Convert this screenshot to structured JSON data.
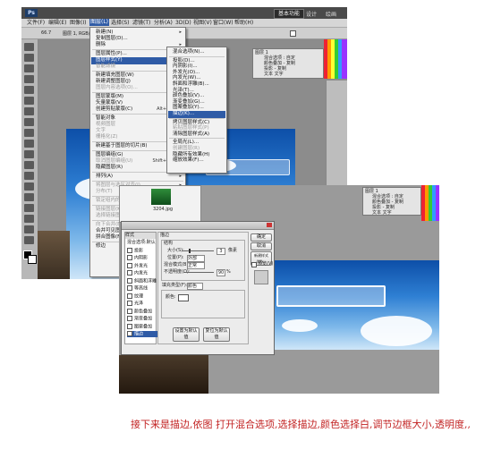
{
  "screen1": {
    "menubar": [
      "文件(F)",
      "编辑(E)",
      "图像(I)",
      "图层(L)",
      "选择(S)",
      "滤镜(T)",
      "分析(A)",
      "3D(D)",
      "视图(V)",
      "窗口(W)",
      "帮助(H)"
    ],
    "workspace_button": "基本功能",
    "top_right_items": [
      "设计",
      "绘画"
    ],
    "zoom": "66.7",
    "tab_title": "图层 1, RGB/8",
    "layer_menu": [
      {
        "label": "新建(N)",
        "arrow": true
      },
      {
        "label": "复制图层(D)...",
        "arrow": false
      },
      {
        "label": "删除",
        "arrow": true
      },
      {
        "sep": true
      },
      {
        "label": "图层属性(P)...",
        "arrow": false
      },
      {
        "label": "图层样式(Y)",
        "arrow": true,
        "highlight": true
      },
      {
        "label": "智能滤镜",
        "arrow": false,
        "disabled": true
      },
      {
        "sep": true
      },
      {
        "label": "新建填充图层(W)",
        "arrow": true
      },
      {
        "label": "新建调整图层(J)",
        "arrow": true
      },
      {
        "label": "图层内容选项(O)...",
        "arrow": false,
        "disabled": true
      },
      {
        "sep": true
      },
      {
        "label": "图层蒙版(M)",
        "arrow": true
      },
      {
        "label": "矢量蒙版(V)",
        "arrow": true
      },
      {
        "label": "创建剪贴蒙版(C)",
        "shortcut": "Alt+Ctrl+G"
      },
      {
        "sep": true
      },
      {
        "label": "智能对象",
        "arrow": true
      },
      {
        "label": "视频图层",
        "arrow": true,
        "disabled": true
      },
      {
        "label": "文字",
        "arrow": true,
        "disabled": true
      },
      {
        "label": "栅格化(Z)",
        "arrow": true,
        "disabled": true
      },
      {
        "sep": true
      },
      {
        "label": "新建基于图层的切片(B)",
        "arrow": false
      },
      {
        "sep": true
      },
      {
        "label": "图层编组(G)",
        "shortcut": "Ctrl+G"
      },
      {
        "label": "取消图层编组(U)",
        "shortcut": "Shift+Ctrl+G",
        "disabled": true
      },
      {
        "label": "隐藏图层(R)",
        "arrow": false
      },
      {
        "sep": true
      },
      {
        "label": "排列(A)",
        "arrow": true
      },
      {
        "sep": true
      },
      {
        "label": "将图层与选区对齐(I)",
        "arrow": true,
        "disabled": true
      },
      {
        "label": "分布(T)",
        "arrow": true,
        "disabled": true
      },
      {
        "sep": true
      },
      {
        "label": "锁定组内的所有图层(X)...",
        "disabled": true
      },
      {
        "sep": true
      },
      {
        "label": "链接图层(K)",
        "disabled": true
      },
      {
        "label": "选择链接图层(S)",
        "disabled": true
      },
      {
        "sep": true
      },
      {
        "label": "向下合并(E)",
        "shortcut": "Ctrl+E",
        "disabled": true
      },
      {
        "label": "合并可见图层",
        "shortcut": "Shift+Ctrl+E"
      },
      {
        "label": "拼合图像(F)"
      },
      {
        "sep": true
      },
      {
        "label": "修边",
        "arrow": true
      }
    ],
    "style_submenu": [
      {
        "label": "混合选项(N)..."
      },
      {
        "sep": true
      },
      {
        "label": "投影(D)..."
      },
      {
        "label": "内阴影(I)..."
      },
      {
        "label": "外发光(O)..."
      },
      {
        "label": "内发光(W)..."
      },
      {
        "label": "斜面和浮雕(B)..."
      },
      {
        "label": "光泽(T)..."
      },
      {
        "label": "颜色叠加(V)..."
      },
      {
        "label": "渐变叠加(G)..."
      },
      {
        "label": "图案叠加(Y)..."
      },
      {
        "label": "描边(K)...",
        "highlight": true
      },
      {
        "sep": true
      },
      {
        "label": "拷贝图层样式(C)"
      },
      {
        "label": "粘贴图层样式(P)",
        "disabled": true
      },
      {
        "label": "清除图层样式(A)"
      },
      {
        "sep": true
      },
      {
        "label": "全局光(L)..."
      },
      {
        "label": "创建图层(R)",
        "disabled": true
      },
      {
        "label": "隐藏所有效果(H)"
      },
      {
        "label": "缩放效果(F)..."
      }
    ],
    "layers_panel": [
      "图层 1",
      "混合选项 : 自定",
      "颜色叠加 - 复制",
      "投影 - 复制",
      "文本 文字"
    ]
  },
  "screen2": {
    "file_label": "3204.jpg",
    "dialog": {
      "styles_header": "样式",
      "styles": [
        {
          "label": "混合选项:默认"
        },
        {
          "label": "投影",
          "check": true
        },
        {
          "label": "内阴影",
          "check": true
        },
        {
          "label": "外发光",
          "check": true
        },
        {
          "label": "内发光",
          "check": true
        },
        {
          "label": "斜面和浮雕",
          "check": true
        },
        {
          "label": "等高线",
          "check": true
        },
        {
          "label": "纹理",
          "check": true
        },
        {
          "label": "光泽",
          "check": true
        },
        {
          "label": "颜色叠加",
          "check": true
        },
        {
          "label": "渐变叠加",
          "check": true
        },
        {
          "label": "图案叠加",
          "check": true
        },
        {
          "label": "描边",
          "check": true,
          "selected": true
        }
      ],
      "section_title": "描边",
      "structure_title": "结构",
      "size_label": "大小(S):",
      "size_value": "3",
      "size_unit": "像素",
      "position_label": "位置(P):",
      "position_value": "外部",
      "blend_label": "混合模式(B):",
      "blend_value": "正常",
      "opacity_label": "不透明度(O):",
      "opacity_value": "90",
      "opacity_unit": "%",
      "fill_label": "填充类型(F):",
      "fill_value": "颜色",
      "color_label": "颜色:",
      "buttons": [
        "确定",
        "取消",
        "新建样式(W)...",
        "预览(V)"
      ],
      "default_buttons": [
        "设置为默认值",
        "复位为默认值"
      ]
    },
    "layers_panel": [
      "图层 1",
      "混合选项 : 自定",
      "颜色叠加 - 复制",
      "投影 - 复制",
      "文本 文字"
    ]
  },
  "caption": "接下来是描边,依图 打开混合选项,选择描边,颜色选择白,调节边框大小,透明度,,"
}
